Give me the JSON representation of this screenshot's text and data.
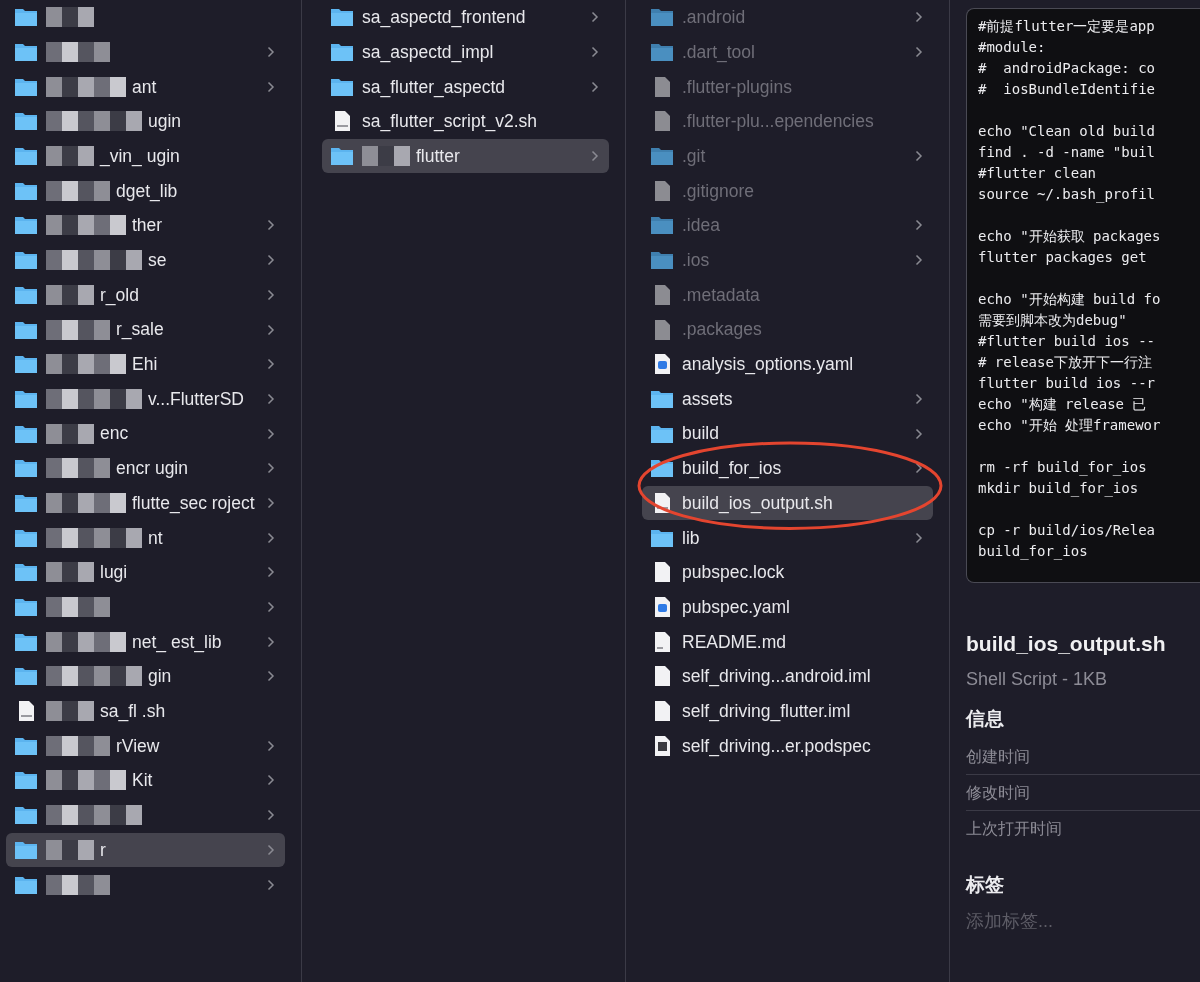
{
  "columns": [
    {
      "items": [
        {
          "kind": "folder",
          "redacted": true,
          "chevron": false,
          "selected": false
        },
        {
          "kind": "folder",
          "redacted": true,
          "chevron": true,
          "selected": false
        },
        {
          "kind": "folder",
          "name": "ant",
          "redacted": true,
          "chevron": true,
          "selected": false
        },
        {
          "kind": "folder",
          "name": "ugin",
          "redacted": true,
          "chevron": false,
          "selected": false
        },
        {
          "kind": "folder",
          "name": "_vin_ ugin",
          "redacted": true,
          "chevron": false,
          "selected": false
        },
        {
          "kind": "folder",
          "name": "dget_lib",
          "redacted": true,
          "chevron": false,
          "selected": false
        },
        {
          "kind": "folder",
          "name": "ther",
          "redacted": true,
          "chevron": true,
          "selected": false
        },
        {
          "kind": "folder",
          "name": "se",
          "redacted": true,
          "chevron": true,
          "selected": false
        },
        {
          "kind": "folder",
          "name": "r_old",
          "redacted": true,
          "chevron": true,
          "selected": false
        },
        {
          "kind": "folder",
          "name": "r_sale",
          "redacted": true,
          "chevron": true,
          "selected": false
        },
        {
          "kind": "folder",
          "name": "Ehi",
          "redacted": true,
          "chevron": true,
          "selected": false
        },
        {
          "kind": "folder",
          "name": "v...FlutterSD",
          "redacted": true,
          "chevron": true,
          "selected": false
        },
        {
          "kind": "folder",
          "name": "enc",
          "redacted": true,
          "chevron": true,
          "selected": false
        },
        {
          "kind": "folder",
          "name": "encr ugin",
          "redacted": true,
          "chevron": true,
          "selected": false
        },
        {
          "kind": "folder",
          "name": "flutte_sec roject",
          "redacted": true,
          "chevron": true,
          "selected": false
        },
        {
          "kind": "folder",
          "name": "nt",
          "redacted": true,
          "chevron": true,
          "selected": false
        },
        {
          "kind": "folder",
          "name": "lugi",
          "redacted": true,
          "chevron": true,
          "selected": false
        },
        {
          "kind": "folder",
          "redacted": true,
          "chevron": true,
          "selected": false
        },
        {
          "kind": "folder",
          "name": "net_ est_lib",
          "redacted": true,
          "chevron": true,
          "selected": false
        },
        {
          "kind": "folder",
          "name": "gin",
          "redacted": true,
          "chevron": true,
          "selected": false
        },
        {
          "kind": "shell",
          "name": "sa_fl .sh",
          "redacted": true,
          "chevron": false,
          "selected": false
        },
        {
          "kind": "folder",
          "name": "rView",
          "redacted": true,
          "chevron": true,
          "selected": false
        },
        {
          "kind": "folder",
          "name": "Kit",
          "redacted": true,
          "chevron": true,
          "selected": false
        },
        {
          "kind": "folder",
          "redacted": true,
          "chevron": true,
          "selected": false
        },
        {
          "kind": "folder",
          "name": "r",
          "redacted": true,
          "chevron": true,
          "selected": true
        },
        {
          "kind": "folder",
          "redacted": true,
          "chevron": true,
          "selected": false
        }
      ]
    },
    {
      "items": [
        {
          "kind": "folder",
          "name": "sa_aspectd_frontend",
          "redacted": false,
          "chevron": true,
          "selected": false
        },
        {
          "kind": "folder",
          "name": "sa_aspectd_impl",
          "redacted": false,
          "chevron": true,
          "selected": false
        },
        {
          "kind": "folder",
          "name": "sa_flutter_aspectd",
          "redacted": false,
          "chevron": true,
          "selected": false
        },
        {
          "kind": "shell",
          "name": "sa_flutter_script_v2.sh",
          "redacted": false,
          "chevron": false,
          "selected": false
        },
        {
          "kind": "folder",
          "name": "flutter",
          "redacted": true,
          "chevron": true,
          "selected": true
        }
      ]
    },
    {
      "items": [
        {
          "kind": "folder",
          "name": ".android",
          "hidden": true,
          "chevron": true,
          "selected": false
        },
        {
          "kind": "folder",
          "name": ".dart_tool",
          "hidden": true,
          "chevron": true,
          "selected": false
        },
        {
          "kind": "file",
          "name": ".flutter-plugins",
          "hidden": true,
          "chevron": false,
          "selected": false
        },
        {
          "kind": "file",
          "name": ".flutter-plu...ependencies",
          "hidden": true,
          "chevron": false,
          "selected": false
        },
        {
          "kind": "folder",
          "name": ".git",
          "hidden": true,
          "chevron": true,
          "selected": false
        },
        {
          "kind": "file",
          "name": ".gitignore",
          "hidden": true,
          "chevron": false,
          "selected": false
        },
        {
          "kind": "folder",
          "name": ".idea",
          "hidden": true,
          "chevron": true,
          "selected": false
        },
        {
          "kind": "folder",
          "name": ".ios",
          "hidden": true,
          "chevron": true,
          "selected": false
        },
        {
          "kind": "file",
          "name": ".metadata",
          "hidden": true,
          "chevron": false,
          "selected": false
        },
        {
          "kind": "file",
          "name": ".packages",
          "hidden": true,
          "chevron": false,
          "selected": false
        },
        {
          "kind": "yaml",
          "name": "analysis_options.yaml",
          "hidden": false,
          "chevron": false,
          "selected": false
        },
        {
          "kind": "folder",
          "name": "assets",
          "hidden": false,
          "chevron": true,
          "selected": false
        },
        {
          "kind": "folder",
          "name": "build",
          "hidden": false,
          "chevron": true,
          "selected": false
        },
        {
          "kind": "folder",
          "name": "build_for_ios",
          "hidden": false,
          "chevron": true,
          "selected": false,
          "circled": true
        },
        {
          "kind": "shell",
          "name": "build_ios_output.sh",
          "hidden": false,
          "chevron": false,
          "selected": true,
          "circled": true
        },
        {
          "kind": "folder",
          "name": "lib",
          "hidden": false,
          "chevron": true,
          "selected": false
        },
        {
          "kind": "file",
          "name": "pubspec.lock",
          "hidden": false,
          "chevron": false,
          "selected": false
        },
        {
          "kind": "yaml",
          "name": "pubspec.yaml",
          "hidden": false,
          "chevron": false,
          "selected": false
        },
        {
          "kind": "md",
          "name": "README.md",
          "hidden": false,
          "chevron": false,
          "selected": false
        },
        {
          "kind": "file",
          "name": "self_driving...android.iml",
          "hidden": false,
          "chevron": false,
          "selected": false
        },
        {
          "kind": "file",
          "name": "self_driving_flutter.iml",
          "hidden": false,
          "chevron": false,
          "selected": false
        },
        {
          "kind": "podspec",
          "name": "self_driving...er.podspec",
          "hidden": false,
          "chevron": false,
          "selected": false
        }
      ]
    }
  ],
  "preview": {
    "code_blocks": [
      [
        "#前提flutter一定要是app",
        "#module:",
        "#  androidPackage: co",
        "#  iosBundleIdentifie"
      ],
      [
        "echo \"Clean old build",
        "find . -d -name \"buil",
        "#flutter clean",
        "source ~/.bash_profil"
      ],
      [
        "echo \"开始获取 packages",
        "flutter packages get"
      ],
      [
        "echo \"开始构建 build fo",
        "需要到脚本改为debug\"",
        "#flutter build ios --",
        "# release下放开下一行注",
        "flutter build ios --r",
        "echo \"构建 release 已",
        "echo \"开始 处理framewor"
      ],
      [
        "rm -rf build_for_ios",
        "mkdir build_for_ios"
      ],
      [
        "cp -r build/ios/Relea",
        "build_for_ios"
      ]
    ],
    "file_name": "build_ios_output.sh",
    "file_info": "Shell Script - 1KB",
    "info_heading": "信息",
    "info_rows": [
      "创建时间",
      "修改时间",
      "上次打开时间"
    ],
    "tags_heading": "标签",
    "tags_placeholder": "添加标签..."
  }
}
